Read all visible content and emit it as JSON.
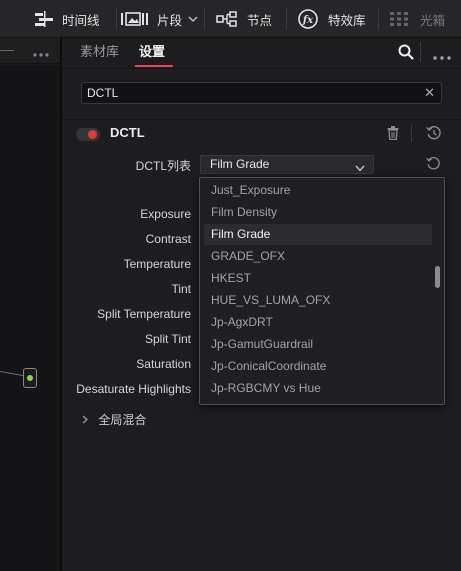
{
  "toolbar": {
    "timeline_label": "时间线",
    "clips_label": "片段",
    "nodes_label": "节点",
    "effects_label": "特效库",
    "lightbox_label": "光箱"
  },
  "inspector": {
    "tabs": [
      {
        "label": "素材库",
        "active": false
      },
      {
        "label": "设置",
        "active": true
      }
    ],
    "search_value": "DCTL",
    "section_title": "DCTL",
    "enabled": true,
    "dctl_list_label": "DCTL列表",
    "dctl_selected": "Film Grade",
    "params": [
      "Exposure",
      "Contrast",
      "Temperature",
      "Tint",
      "Split Temperature",
      "Split Tint",
      "Saturation",
      "Desaturate Highlights"
    ],
    "dropdown_options": [
      "Just_Exposure",
      "Film Density",
      "Film Grade",
      "GRADE_OFX",
      "HKEST",
      "HUE_VS_LUMA_OFX",
      "Jp-AgxDRT",
      "Jp-GamutGuardrail",
      "Jp-ConicalCoordinate",
      "Jp-RGBCMY vs Hue"
    ],
    "global_mix_label": "全局混合"
  },
  "colors": {
    "accent_red": "#e0485b",
    "toggle_red": "#e03a3a",
    "node_green": "#8fd14f"
  }
}
